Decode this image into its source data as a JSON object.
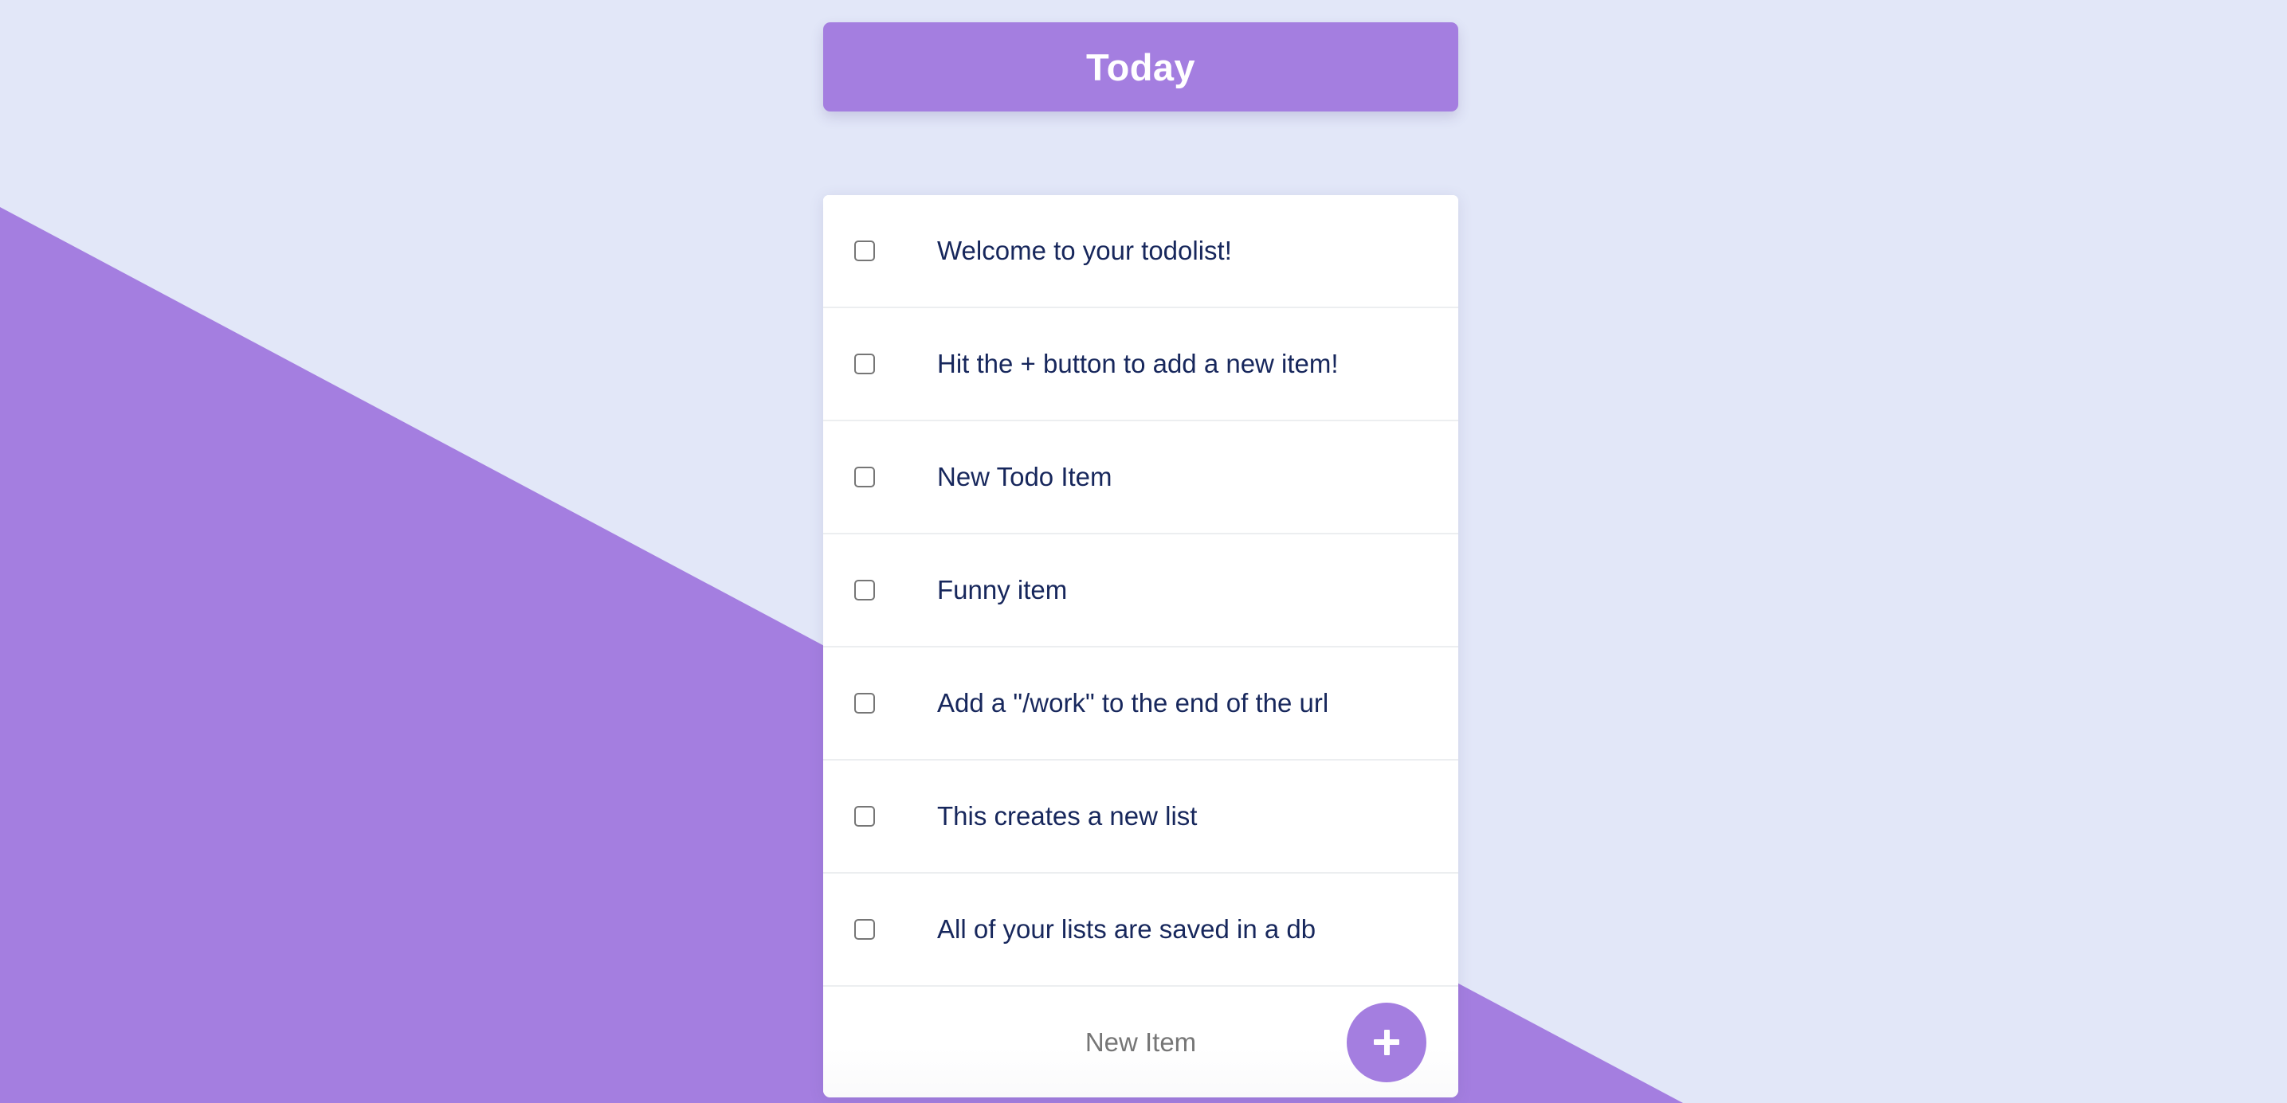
{
  "theme": {
    "background": "#e2e7f8",
    "accent_purple": "#a47ee0",
    "text_navy": "#17275c",
    "placeholder_gray": "#767676",
    "divider": "#eceef0",
    "card_white": "#ffffff"
  },
  "header": {
    "title": "Today"
  },
  "list": {
    "items": [
      {
        "label": "Welcome to your todolist!",
        "checked": false
      },
      {
        "label": "Hit the + button to add a new item!",
        "checked": false
      },
      {
        "label": "New Todo Item",
        "checked": false
      },
      {
        "label": "Funny item",
        "checked": false
      },
      {
        "label": "Add a \"/work\" to the end of the url",
        "checked": false
      },
      {
        "label": "This creates a new list",
        "checked": false
      },
      {
        "label": "All of your lists are saved in a db",
        "checked": false
      }
    ]
  },
  "footer": {
    "new_item_placeholder": "New Item",
    "new_item_value": "",
    "add_button_icon": "plus-icon",
    "add_button_label": "+"
  }
}
